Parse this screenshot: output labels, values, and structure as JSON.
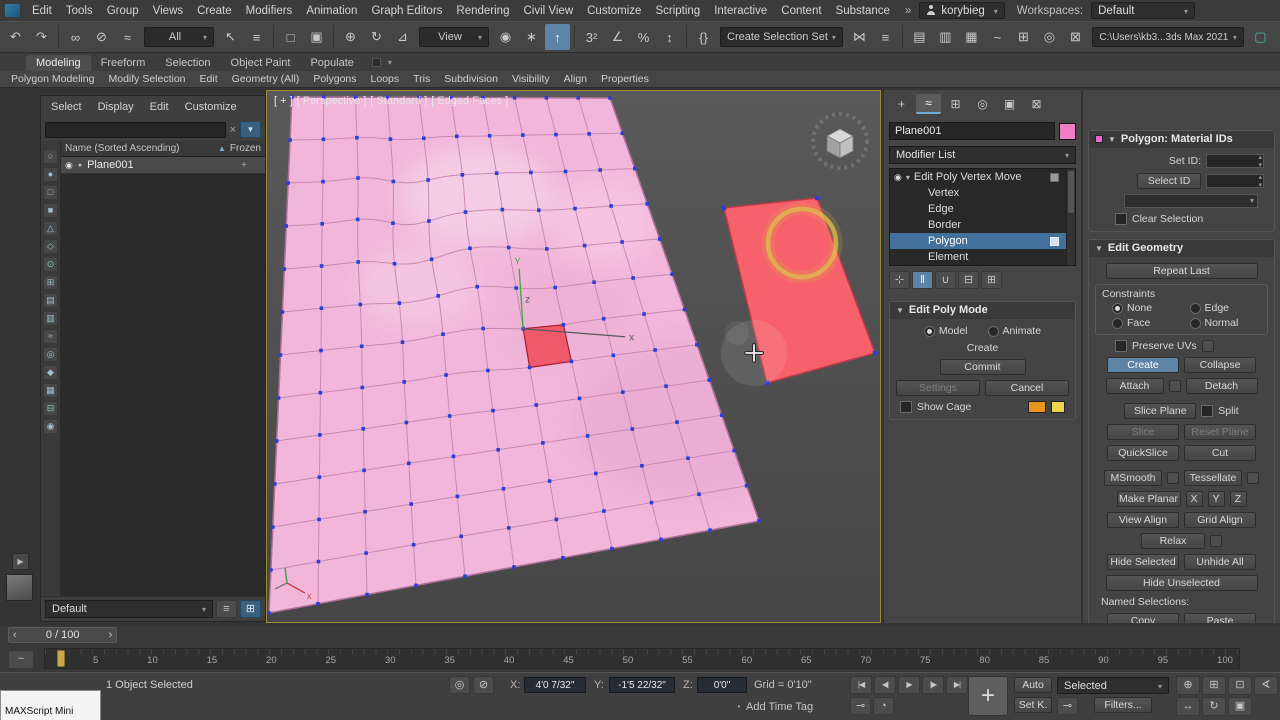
{
  "menubar": {
    "items": [
      "Edit",
      "Tools",
      "Group",
      "Views",
      "Create",
      "Modifiers",
      "Animation",
      "Graph Editors",
      "Rendering",
      "Civil View",
      "Customize",
      "Scripting",
      "Interactive",
      "Content",
      "Substance"
    ],
    "overflow": "»",
    "user": "korybieg",
    "workspaces_label": "Workspaces:",
    "workspace": "Default"
  },
  "toolbar": {
    "items": [
      {
        "name": "undo-icon",
        "cls": "tb-icon",
        "glyph": "↶"
      },
      {
        "name": "redo-icon",
        "cls": "tb-icon",
        "glyph": "↷"
      },
      {
        "cls": "tb-sep",
        "ia": "false"
      },
      {
        "name": "select-and-link-icon",
        "cls": "tb-icon",
        "glyph": "∞"
      },
      {
        "name": "unlink-selection-icon",
        "cls": "tb-icon",
        "glyph": "⊘"
      },
      {
        "name": "bind-to-spacewarp-icon",
        "cls": "tb-icon",
        "glyph": "≈"
      },
      {
        "name": "selection-filter-dropdown",
        "cls": "tb-dd",
        "label": "All",
        "caretcls": "caret"
      },
      {
        "name": "select-object-icon",
        "cls": "tb-icon",
        "glyph": "↖"
      },
      {
        "name": "select-by-name-icon",
        "cls": "tb-icon",
        "glyph": "≡"
      },
      {
        "cls": "tb-sep",
        "ia": "false"
      },
      {
        "name": "rectangular-region-icon",
        "cls": "tb-icon",
        "glyph": "□"
      },
      {
        "name": "window-crossing-icon",
        "cls": "tb-icon",
        "glyph": "▣"
      },
      {
        "cls": "tb-sep",
        "ia": "false"
      },
      {
        "name": "select-and-move-icon",
        "cls": "tb-icon",
        "glyph": "⊕"
      },
      {
        "name": "select-and-rotate-icon",
        "cls": "tb-icon",
        "glyph": "↻"
      },
      {
        "name": "select-and-scale-icon",
        "cls": "tb-icon",
        "glyph": "⊿"
      },
      {
        "name": "reference-coordinate-dropdown",
        "cls": "tb-dd",
        "label": "View",
        "caretcls": "caret"
      },
      {
        "name": "use-pivot-point-icon",
        "cls": "tb-icon",
        "glyph": "◉"
      },
      {
        "name": "select-and-manipulate-icon",
        "cls": "tb-icon",
        "glyph": "∗"
      },
      {
        "name": "keyboard-override-icon",
        "cls": "tb-icon active",
        "glyph": "↑"
      },
      {
        "cls": "tb-sep",
        "ia": "false"
      },
      {
        "name": "snaps-toggle-icon",
        "cls": "tb-icon",
        "glyph": "3²"
      },
      {
        "name": "angle-snap-icon",
        "cls": "tb-icon",
        "glyph": "∠"
      },
      {
        "name": "percent-snap-icon",
        "cls": "tb-icon",
        "glyph": "%"
      },
      {
        "name": "spinner-snap-icon",
        "cls": "tb-icon",
        "glyph": "↕"
      },
      {
        "cls": "tb-sep",
        "ia": "false"
      },
      {
        "name": "edit-named-selection-sets-icon",
        "cls": "tb-icon",
        "glyph": "{}"
      },
      {
        "name": "named-selection-sets-dropdown",
        "cls": "tb-dd wide",
        "label": "Create Selection Set",
        "caretcls": "caret"
      },
      {
        "name": "mirror-icon",
        "cls": "tb-icon",
        "glyph": "⋈"
      },
      {
        "name": "align-icon",
        "cls": "tb-icon",
        "glyph": "≡"
      },
      {
        "cls": "tb-sep",
        "ia": "false"
      },
      {
        "name": "toggle-scene-explorer-icon",
        "cls": "tb-icon",
        "glyph": "▤"
      },
      {
        "name": "toggle-layer-explorer-icon",
        "cls": "tb-icon",
        "glyph": "▥"
      },
      {
        "name": "toggle-ribbon-icon",
        "cls": "tb-icon",
        "glyph": "▦"
      },
      {
        "name": "curve-editor-icon",
        "cls": "tb-icon",
        "glyph": "~"
      },
      {
        "name": "schematic-view-icon",
        "cls": "tb-icon",
        "glyph": "⊞"
      },
      {
        "name": "material-editor-icon",
        "cls": "tb-icon",
        "glyph": "◎"
      },
      {
        "name": "render-setup-icon",
        "cls": "tb-icon",
        "glyph": "⊠"
      },
      {
        "name": "project-folder-field",
        "cls": "tb-field",
        "label": "C:\\Users\\kb3...3ds Max 2021",
        "caretcls": "caret"
      },
      {
        "name": "render-frame-icon",
        "cls": "tb-icon teal",
        "glyph": "▢"
      }
    ]
  },
  "ribbon": {
    "tabs": [
      {
        "name": "tab-modeling",
        "cls": "rtab active",
        "label": "Modeling"
      },
      {
        "name": "tab-freeform",
        "cls": "rtab",
        "label": "Freeform"
      },
      {
        "name": "tab-selection",
        "cls": "rtab",
        "label": "Selection"
      },
      {
        "name": "tab-object-paint",
        "cls": "rtab",
        "label": "Object Paint"
      },
      {
        "name": "tab-populate",
        "cls": "rtab",
        "label": "Populate"
      }
    ],
    "panels": [
      "Polygon Modeling",
      "Modify Selection",
      "Edit",
      "Geometry (All)",
      "Polygons",
      "Loops",
      "Tris",
      "Subdivision",
      "Visibility",
      "Align",
      "Properties"
    ]
  },
  "explorer": {
    "tabs": [
      "Select",
      "Display",
      "Edit",
      "Customize"
    ],
    "clear_glyph": "×",
    "filter_glyph": "▼",
    "col_name": "Name (Sorted Ascending)",
    "sort_glyph": "▲",
    "col_frozen": "Frozen",
    "row": {
      "eye": "◉",
      "dot": "●",
      "name": "Plane001",
      "frozen_glyph": "+"
    },
    "strip": [
      {
        "name": "display-all-icon",
        "cls": "strip-icon",
        "glyph": "○"
      },
      {
        "name": "display-geometry-icon",
        "cls": "strip-icon",
        "glyph": "●"
      },
      {
        "name": "display-shapes-icon",
        "cls": "strip-icon",
        "glyph": "□"
      },
      {
        "name": "display-lights-icon",
        "cls": "strip-icon",
        "glyph": "■"
      },
      {
        "name": "display-cameras-icon",
        "cls": "strip-icon",
        "glyph": "△"
      },
      {
        "name": "display-helpers-icon",
        "cls": "strip-icon",
        "glyph": "◇"
      },
      {
        "name": "display-spacewarps-icon",
        "cls": "strip-icon",
        "glyph": "⊙"
      },
      {
        "name": "display-particles-icon",
        "cls": "strip-icon",
        "glyph": "⊞"
      },
      {
        "name": "display-bones-icon",
        "cls": "strip-icon",
        "glyph": "▤"
      },
      {
        "name": "display-groups-icon",
        "cls": "strip-icon",
        "glyph": "▥"
      },
      {
        "name": "display-xrefs-icon",
        "cls": "strip-icon",
        "glyph": "≈"
      },
      {
        "name": "display-materials-icon",
        "cls": "strip-icon",
        "glyph": "◎"
      },
      {
        "name": "display-containers-icon",
        "cls": "strip-icon",
        "glyph": "◆"
      },
      {
        "name": "display-frozen-icon",
        "cls": "strip-icon",
        "glyph": "▦"
      },
      {
        "name": "display-hidden-icon",
        "cls": "strip-icon",
        "glyph": "⊟"
      },
      {
        "name": "sync-selection-icon",
        "cls": "strip-icon",
        "glyph": "◉"
      }
    ],
    "footer": {
      "value": "Default",
      "icons": [
        {
          "name": "layer-explorer-mode-icon",
          "cls": "ibox",
          "glyph": "≡"
        },
        {
          "name": "scene-explorer-settings-icon",
          "cls": "ibox blue",
          "glyph": "⊞"
        }
      ]
    }
  },
  "viewport": {
    "label_segments": [
      "[ + ]",
      "[ Perspective ]",
      "[ Standard ]",
      "[ Edged Faces ]"
    ],
    "gizmo": {
      "y": "Y",
      "z": "z",
      "x": "x"
    },
    "tripod_x": "x"
  },
  "command_panel": {
    "tabs": [
      {
        "name": "create-tab",
        "cls": "cp-tab",
        "glyph": "+"
      },
      {
        "name": "modify-tab",
        "cls": "cp-tab active",
        "glyph": "≈"
      },
      {
        "name": "hierarchy-tab",
        "cls": "cp-tab",
        "glyph": "⊞"
      },
      {
        "name": "motion-tab",
        "cls": "cp-tab",
        "glyph": "◎"
      },
      {
        "name": "display-tab",
        "cls": "cp-tab",
        "glyph": "▣"
      },
      {
        "name": "utilities-tab",
        "cls": "cp-tab",
        "glyph": "⊠"
      }
    ],
    "object_name": "Plane001",
    "modifier_list": "Modifier List",
    "stack": [
      {
        "name": "stack-item-edit-poly",
        "cls": "stack-row mod",
        "eye": "◉",
        "arr": "▾",
        "label": "Edit Poly Vertex Move",
        "tailcls": "row-box gray"
      },
      {
        "name": "stack-item-vertex",
        "cls": "stack-row sub",
        "label": "Vertex",
        "tailcls": "row-box off"
      },
      {
        "name": "stack-item-edge",
        "cls": "stack-row sub",
        "label": "Edge",
        "tailcls": "row-box off"
      },
      {
        "name": "stack-item-border",
        "cls": "stack-row sub",
        "label": "Border",
        "tailcls": "row-box off"
      },
      {
        "name": "stack-item-polygon",
        "cls": "stack-row sub sel",
        "label": "Polygon",
        "tailcls": "row-box blue"
      },
      {
        "name": "stack-item-element",
        "cls": "stack-row sub",
        "label": "Element",
        "tailcls": "row-box off"
      }
    ],
    "stack_buttons": [
      {
        "name": "pin-stack-icon",
        "cls": "ibox",
        "glyph": "⊹"
      },
      {
        "name": "show-end-result-icon",
        "cls": "ibox active",
        "glyph": "‖"
      },
      {
        "name": "make-unique-icon",
        "cls": "ibox",
        "glyph": "∪"
      },
      {
        "name": "remove-modifier-icon",
        "cls": "ibox",
        "glyph": "⊟"
      },
      {
        "name": "configure-modifier-sets-icon",
        "cls": "ibox",
        "glyph": "⊞"
      }
    ]
  },
  "edit_poly_mode": {
    "title": "Edit Poly Mode",
    "model": "Model",
    "animate": "Animate",
    "op_label": "Create",
    "commit": "Commit",
    "settings": "Settings",
    "cancel": "Cancel",
    "show_cage": "Show Cage"
  },
  "material_ids": {
    "title": "Polygon: Material IDs",
    "set_id_label": "Set ID:",
    "select_id": "Select ID",
    "clear_selection": "Clear Selection"
  },
  "edit_geometry": {
    "title": "Edit Geometry",
    "repeat_last": "Repeat Last",
    "constraints": "Constraints",
    "r_none": "None",
    "r_edge": "Edge",
    "r_face": "Face",
    "r_normal": "Normal",
    "preserve_uvs": "Preserve UVs",
    "create": "Create",
    "collapse": "Collapse",
    "attach": "Attach",
    "detach": "Detach",
    "slice_plane": "Slice Plane",
    "split": "Split",
    "slice": "Slice",
    "reset_plane": "Reset Plane",
    "quickslice": "QuickSlice",
    "cut": "Cut",
    "msmooth": "MSmooth",
    "tessellate": "Tessellate",
    "make_planar": "Make Planar",
    "x": "X",
    "y": "Y",
    "z": "Z",
    "view_align": "View Align",
    "grid_align": "Grid Align",
    "relax": "Relax",
    "hide_selected": "Hide Selected",
    "unhide_all": "Unhide All",
    "hide_unselected": "Hide Unselected",
    "named_selections": "Named Selections:",
    "copy": "Copy",
    "paste": "Paste"
  },
  "timeline": {
    "prev": "‹",
    "frame": "0 / 100",
    "next": "›",
    "mini_curve_glyph": "~",
    "ticks": [
      "5",
      "10",
      "15",
      "20",
      "25",
      "30",
      "35",
      "40",
      "45",
      "50",
      "55",
      "60",
      "65",
      "70",
      "75",
      "80",
      "85",
      "90",
      "95",
      "100"
    ]
  },
  "statusbar": {
    "selected": "1 Object Selected",
    "maxscript": "MAXScript Mini",
    "mode_icons": [
      {
        "name": "isolate-selection-icon",
        "cls": "ibox",
        "glyph": "◎"
      },
      {
        "name": "lock-selection-icon",
        "cls": "ibox",
        "glyph": "⊘"
      }
    ],
    "x_label": "X:",
    "x_value": "4'0 7/32\"",
    "y_label": "Y:",
    "y_value": "-1'5 22/32\"",
    "z_label": "Z:",
    "z_value": "0'0\"",
    "grid": "Grid = 0'10\"",
    "clock_glyph": "◔",
    "add_time_tag": "Add Time Tag",
    "transport": [
      {
        "name": "go-to-start-button",
        "cls": "ibox",
        "glyph": "|◀"
      },
      {
        "name": "previous-frame-button",
        "cls": "ibox",
        "glyph": "◀|"
      },
      {
        "name": "play-button",
        "cls": "ibox",
        "glyph": "▶"
      },
      {
        "name": "next-frame-button",
        "cls": "ibox",
        "glyph": "|▶"
      },
      {
        "name": "go-to-end-button",
        "cls": "ibox",
        "glyph": "▶|"
      }
    ],
    "anim_icons": [
      {
        "name": "key-mode-toggle-icon",
        "cls": "ibox",
        "glyph": "⊸"
      },
      {
        "name": "time-configuration-icon",
        "cls": "ibox",
        "glyph": "◔"
      }
    ],
    "big_key": "+",
    "auto": "Auto",
    "key_filter_value": "Selected",
    "set_k": "Set K.",
    "filters": "Filters...",
    "nav1": [
      {
        "name": "zoom-icon",
        "cls": "ibox",
        "glyph": "⊕"
      },
      {
        "name": "zoom-all-icon",
        "cls": "ibox",
        "glyph": "⊞"
      },
      {
        "name": "zoom-extents-icon",
        "cls": "ibox",
        "glyph": "⊡"
      },
      {
        "name": "field-of-view-icon",
        "cls": "ibox",
        "glyph": "∢"
      }
    ],
    "nav2": [
      {
        "name": "pan-icon",
        "cls": "ibox",
        "glyph": "↔"
      },
      {
        "name": "orbit-icon",
        "cls": "ibox",
        "glyph": "↻"
      },
      {
        "name": "maximize-viewport-icon",
        "cls": "ibox",
        "glyph": "▣"
      }
    ]
  }
}
